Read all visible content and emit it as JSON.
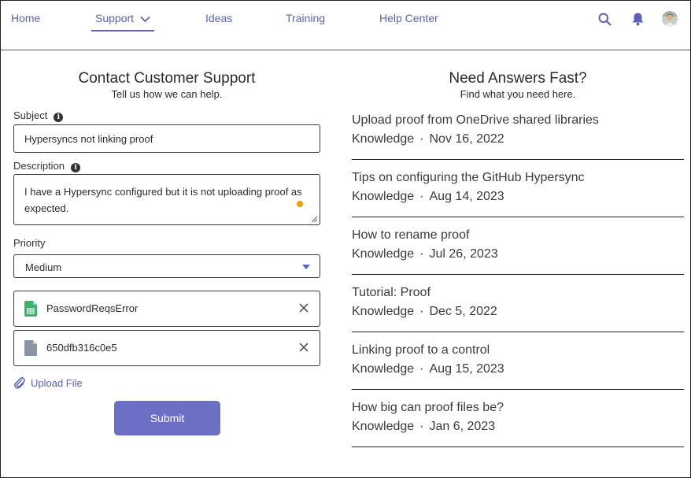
{
  "nav": {
    "items": [
      {
        "label": "Home"
      },
      {
        "label": "Support"
      },
      {
        "label": "Ideas"
      },
      {
        "label": "Training"
      },
      {
        "label": "Help Center"
      }
    ],
    "icons": [
      "search-icon",
      "bell-icon",
      "avatar"
    ]
  },
  "form": {
    "title": "Contact Customer Support",
    "subtitle": "Tell us how we can help.",
    "subject_label": "Subject",
    "subject_value": "Hypersyncs not  linking proof",
    "description_label": "Description",
    "description_value": "I have a Hypersync configured but it is not uploading proof as expected.",
    "priority_label": "Priority",
    "priority_value": "Medium",
    "attachments": [
      {
        "name": "PasswordReqsError",
        "icon": "spreadsheet-file-icon",
        "color": "#3cb371"
      },
      {
        "name": "650dfb316c0e5",
        "icon": "generic-file-icon",
        "color": "#8a94a3"
      }
    ],
    "upload_label": "Upload File",
    "submit_label": "Submit"
  },
  "answers": {
    "title": "Need Answers Fast?",
    "subtitle": "Find what you need here.",
    "separator": "·",
    "articles": [
      {
        "title": "Upload proof from OneDrive shared libraries",
        "type": "Knowledge",
        "date": "Nov 16, 2022"
      },
      {
        "title": "Tips on configuring the GitHub Hypersync",
        "type": "Knowledge",
        "date": "Aug 14, 2023"
      },
      {
        "title": "How to rename proof",
        "type": "Knowledge",
        "date": "Jul 26, 2023"
      },
      {
        "title": "Tutorial: Proof",
        "type": "Knowledge",
        "date": "Dec 5, 2022"
      },
      {
        "title": "Linking proof to a control",
        "type": "Knowledge",
        "date": "Aug 15, 2023"
      },
      {
        "title": "How big can proof files be?",
        "type": "Knowledge",
        "date": "Jan 6, 2023"
      }
    ]
  },
  "colors": {
    "accent": "#5a63b8",
    "button": "#6b70c5",
    "indicator": "#f2a100"
  }
}
